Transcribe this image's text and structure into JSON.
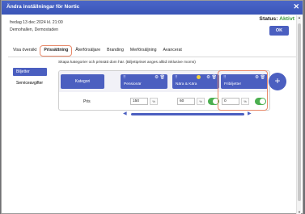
{
  "window": {
    "title": "Ändra inställningar för Nortic",
    "close": "✕"
  },
  "info": {
    "datetime": "fredag 13 dec 2024 kl. 21:00",
    "venue": "Demohallen, Demostaden"
  },
  "status": {
    "label": "Status:",
    "value": "Aktivt",
    "value_color": "#3a9a3a"
  },
  "ok_button": "OK",
  "tabs": [
    "Visa översikt",
    "Prissättning",
    "Återförsäljare",
    "Branding",
    "Merförsäljning",
    "Avancerat"
  ],
  "active_tab": "Prissättning",
  "sidebar": {
    "items": [
      {
        "label": "Biljetter",
        "selected": true
      },
      {
        "label": "Serviceavgifter",
        "selected": false
      }
    ]
  },
  "help_text": "Skapa kategorier och prissätt dom här. (Biljettpriset anges alltid inklusive moms)",
  "grid": {
    "category_header": "Kategori",
    "columns": [
      {
        "name": "Pensionär",
        "price": "150",
        "unit": "%",
        "enabled": true
      },
      {
        "name": "Nära & Kära",
        "price": "60",
        "unit": "%",
        "enabled": true
      },
      {
        "name": "Fribiljetter",
        "price": "0",
        "unit": "%",
        "enabled": true
      }
    ],
    "row_label": "Pris"
  },
  "icons": {
    "drag": "drag-handle-icon",
    "settings": "gear-icon",
    "delete": "trash-icon",
    "add": "plus-icon"
  },
  "colors": {
    "accent": "#4b5fc0",
    "highlight": "#e8896a",
    "toggle_on": "#4caf50"
  }
}
